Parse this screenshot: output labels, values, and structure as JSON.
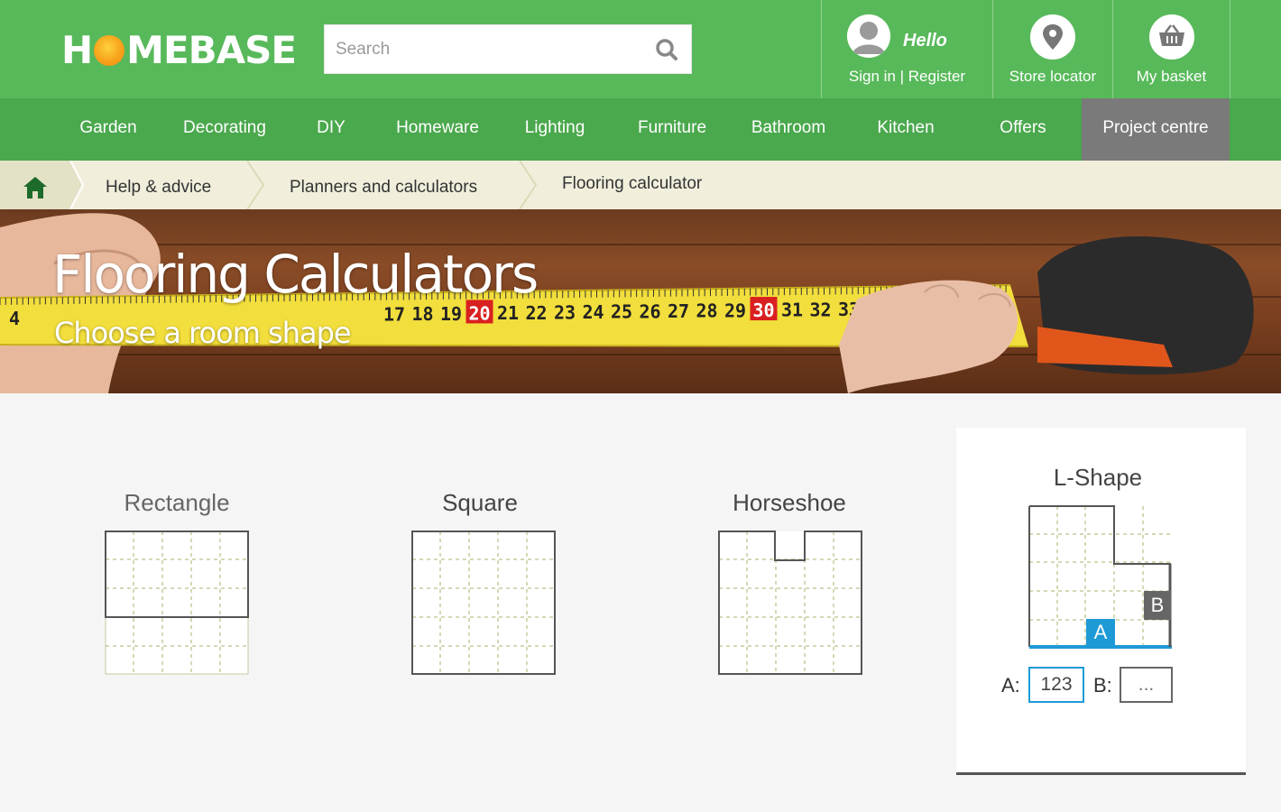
{
  "header": {
    "logo": {
      "before": "H",
      "after": "MEBASE"
    },
    "search": {
      "placeholder": "Search"
    },
    "user": {
      "greeting": "Hello",
      "link": "Sign in | Register"
    },
    "store_locator": "Store locator",
    "basket": "My basket"
  },
  "nav": {
    "items": [
      "Garden",
      "Decorating",
      "DIY",
      "Homeware",
      "Lighting",
      "Furniture",
      "Bathroom",
      "Kitchen",
      "Offers",
      "Project centre"
    ],
    "active": "Project centre"
  },
  "breadcrumb": {
    "items": [
      "Help & advice",
      "Planners and calculators",
      "Flooring calculator"
    ]
  },
  "hero": {
    "title": "Flooring Calculators",
    "subtitle": "Choose a room shape",
    "tape_numbers": [
      "4",
      "17",
      "18",
      "19",
      "20",
      "21",
      "22",
      "23",
      "24",
      "25",
      "26",
      "27",
      "28",
      "29",
      "30",
      "31",
      "32",
      "33"
    ]
  },
  "shapes": {
    "rectangle": "Rectangle",
    "square": "Square",
    "horseshoe": "Horseshoe",
    "lshape": "L-Shape"
  },
  "lshape_form": {
    "a_label": "A:",
    "a_value": "123",
    "b_label": "B:",
    "b_placeholder": "...",
    "marker_a": "A",
    "marker_b": "B"
  },
  "colors": {
    "header_green": "#58b95a",
    "nav_green": "#4aa84d",
    "active_tab": "#7a7a7a",
    "accent_blue": "#1e9ad6"
  }
}
